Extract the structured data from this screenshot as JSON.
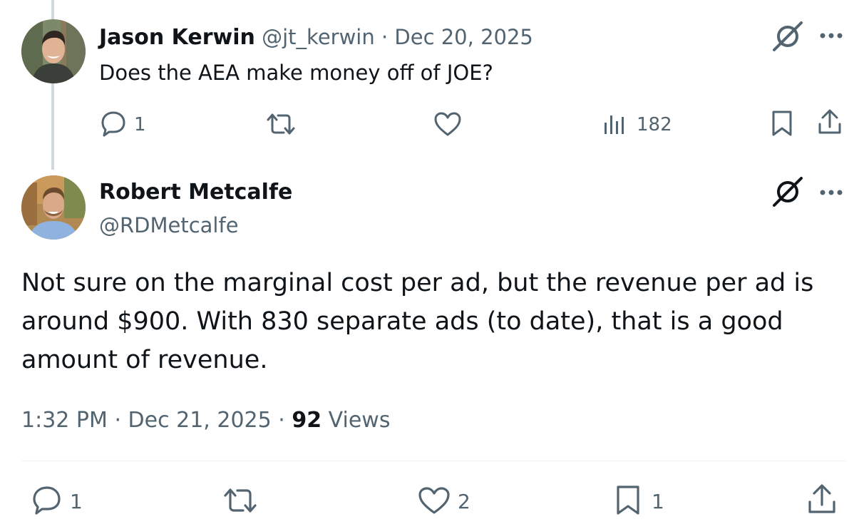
{
  "parent_tweet": {
    "author_name": "Jason Kerwin",
    "handle": "@jt_kerwin",
    "separator": "·",
    "date": "Dec 20, 2025",
    "text": "Does the AEA make money off of JOE?",
    "actions": {
      "reply_count": "1",
      "retweet_count": "",
      "like_count": "",
      "views_count": "182"
    }
  },
  "main_tweet": {
    "author_name": "Robert Metcalfe",
    "handle": "@RDMetcalfe",
    "text": "Not sure on the marginal cost per ad, but the revenue per ad is around $900. With 830 separate ads (to date), that is a good amount of revenue.",
    "time": "1:32 PM",
    "separator": "·",
    "date": "Dec 21, 2025",
    "views_number": "92",
    "views_label": "Views",
    "actions": {
      "reply_count": "1",
      "retweet_count": "",
      "like_count": "2",
      "bookmark_count": "1"
    }
  },
  "icons": {
    "reply": "reply-icon",
    "retweet": "retweet-icon",
    "like": "heart-icon",
    "views": "views-chart-icon",
    "bookmark": "bookmark-icon",
    "share": "share-icon",
    "grok": "grok-icon",
    "more": "more-icon"
  },
  "colors": {
    "text_primary": "#0f1419",
    "text_secondary": "#536471",
    "thread_line": "#cfd9de",
    "divider": "#eff3f4"
  }
}
